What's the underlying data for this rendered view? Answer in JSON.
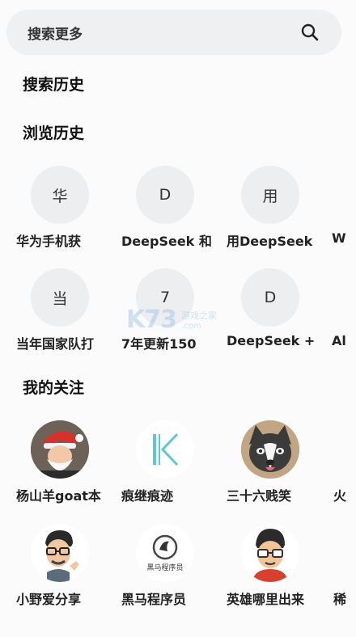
{
  "search": {
    "placeholder": "搜索更多"
  },
  "sections": {
    "search_history": "搜索历史",
    "browse_history": "浏览历史",
    "my_follows": "我的关注"
  },
  "browse_items": [
    {
      "initial": "华",
      "label": "华为手机获"
    },
    {
      "initial": "D",
      "label": "DeepSeek 和"
    },
    {
      "initial": "用",
      "label": "用DeepSeek"
    },
    {
      "initial": "当",
      "label": "当年国家队打"
    },
    {
      "initial": "7",
      "label": "7年更新150"
    },
    {
      "initial": "D",
      "label": "DeepSeek +"
    }
  ],
  "browse_clipped": [
    "W",
    "Al"
  ],
  "follows": [
    {
      "label": "杨山羊goat本",
      "avatar": "santa-avatar-icon"
    },
    {
      "label": "痕继痕迹",
      "avatar": "k-logo-icon"
    },
    {
      "label": "三十六贱笑",
      "avatar": "husky-avatar-icon"
    },
    {
      "label": "小野爱分享",
      "avatar": "cartoon-man-avatar-icon"
    },
    {
      "label": "黑马程序员",
      "avatar": "heima-logo-icon",
      "logo_text": "黑马程序员"
    },
    {
      "label": "英雄哪里出来",
      "avatar": "glasses-man-avatar-icon"
    }
  ],
  "follows_clipped": [
    "火",
    "稀"
  ],
  "watermark": {
    "logo": "K73",
    "text": "游戏之家",
    "url": ".com"
  }
}
